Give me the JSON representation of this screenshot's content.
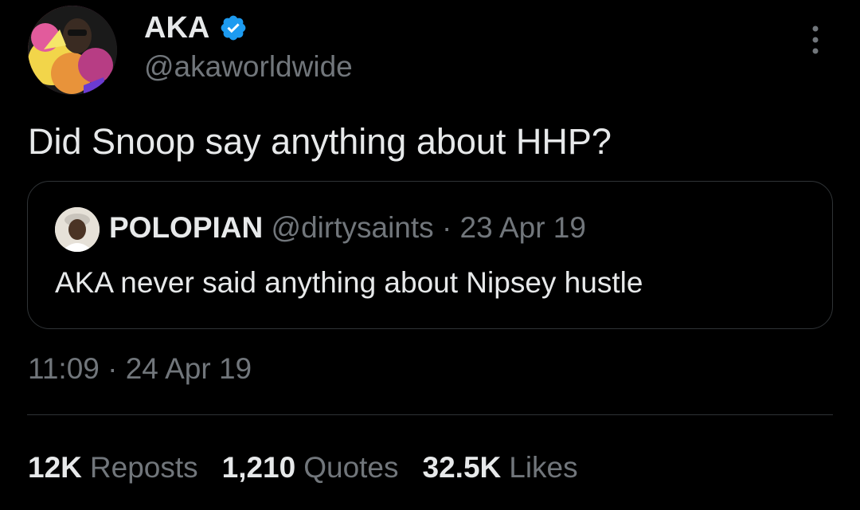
{
  "tweet": {
    "author": {
      "name": "AKA",
      "handle": "@akaworldwide",
      "verified": true,
      "verified_color": "#1d9bf0"
    },
    "text": "Did Snoop say anything about HHP?",
    "quote": {
      "name": "POLOPIAN",
      "handle": "@dirtysaints",
      "separator": "·",
      "date": "23 Apr 19",
      "text": "AKA never said anything about Nipsey hustle"
    },
    "timestamp": "11:09 · 24 Apr 19",
    "stats": {
      "reposts": {
        "count": "12K",
        "label": "Reposts"
      },
      "quotes": {
        "count": "1,210",
        "label": "Quotes"
      },
      "likes": {
        "count": "32.5K",
        "label": "Likes"
      }
    }
  },
  "colors": {
    "background": "#000000",
    "primary_text": "#e7e9ea",
    "secondary_text": "#71767b",
    "border": "#2f3336"
  },
  "icons": {
    "verified": "verified-badge-icon",
    "more": "more-options-icon"
  }
}
